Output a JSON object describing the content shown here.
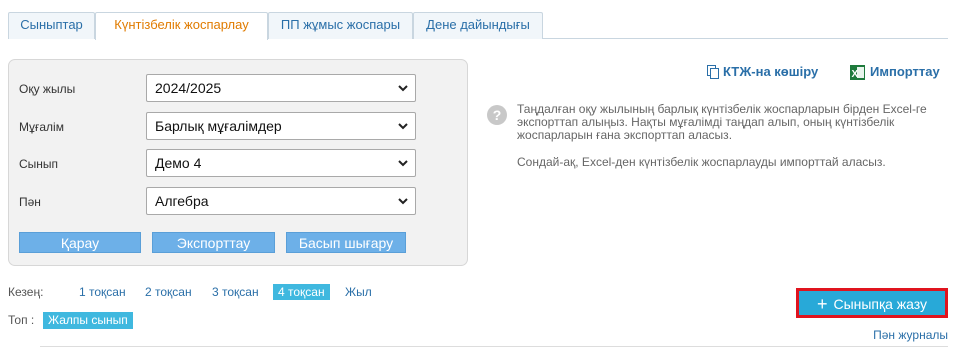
{
  "tabs": [
    {
      "label": "Сыныптар",
      "active": false
    },
    {
      "label": "Күнтізбелік жоспарлау",
      "active": true
    },
    {
      "label": "ПП жұмыс жоспары",
      "active": false
    },
    {
      "label": "Дене дайындығы",
      "active": false
    }
  ],
  "filters": {
    "year": {
      "label": "Оқу жылы",
      "value": "2024/2025"
    },
    "teacher": {
      "label": "Мұғалім",
      "value": "Барлық мұғалімдер"
    },
    "class": {
      "label": "Сынып",
      "value": "Демо 4"
    },
    "subject": {
      "label": "Пән",
      "value": "Алгебра"
    }
  },
  "buttons": {
    "view": "Қарау",
    "export": "Экспорттау",
    "print": "Басып шығару"
  },
  "actions": {
    "copy": "КТЖ-на көшіру",
    "import": "Импорттау"
  },
  "info": {
    "paragraph1": "Таңдалған оқу жылының барлық күнтізбелік жоспарларын бірден Excel-ге экспорттап алыңыз. Нақты мұғалімді таңдап алып, оның күнтізбелік жоспарларын ғана экспорттап аласыз.",
    "paragraph2": "Сондай-ақ, Excel-ден күнтізбелік жоспарлауды импорттай аласыз."
  },
  "period": {
    "label": "Кезең:",
    "items": [
      {
        "label": "1 тоқсан",
        "active": false
      },
      {
        "label": "2 тоқсан",
        "active": false
      },
      {
        "label": "3 тоқсан",
        "active": false
      },
      {
        "label": "4 тоқсан",
        "active": true
      },
      {
        "label": "Жыл",
        "active": false
      }
    ]
  },
  "group": {
    "label": "Топ :",
    "value": "Жалпы сынып"
  },
  "primary_button": "Сыныпқа жазу",
  "journal_link": "Пән журналы",
  "colors": {
    "accent": "#28a9d8",
    "active_tab_text": "#e07b00",
    "link": "#2a6fa8",
    "highlight_border": "#e0141e"
  }
}
